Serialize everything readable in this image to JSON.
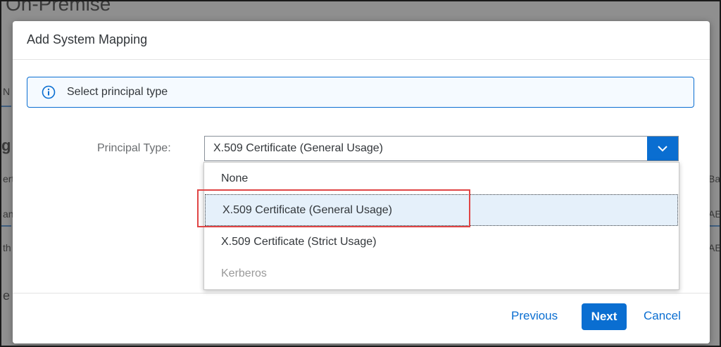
{
  "background": {
    "title": "On-Premise",
    "fragments": [
      "N",
      "g",
      "ert",
      "an",
      "th",
      "e",
      "Ba",
      "AE",
      "AE"
    ]
  },
  "dialog": {
    "title": "Add System Mapping",
    "info": {
      "icon": "info-icon",
      "text": "Select principal type"
    },
    "principal_type": {
      "label": "Principal Type:",
      "value": "X.509 Certificate (General Usage)",
      "options": [
        {
          "label": "None",
          "state": "normal"
        },
        {
          "label": "X.509 Certificate (General Usage)",
          "state": "selected"
        },
        {
          "label": "X.509 Certificate (Strict Usage)",
          "state": "normal"
        },
        {
          "label": "Kerberos",
          "state": "disabled"
        }
      ]
    },
    "footer": {
      "previous_label": "Previous",
      "next_label": "Next",
      "cancel_label": "Cancel"
    }
  },
  "colors": {
    "accent": "#0a6ed1",
    "highlight": "#e04545",
    "selected_bg": "#e5f0fa"
  }
}
